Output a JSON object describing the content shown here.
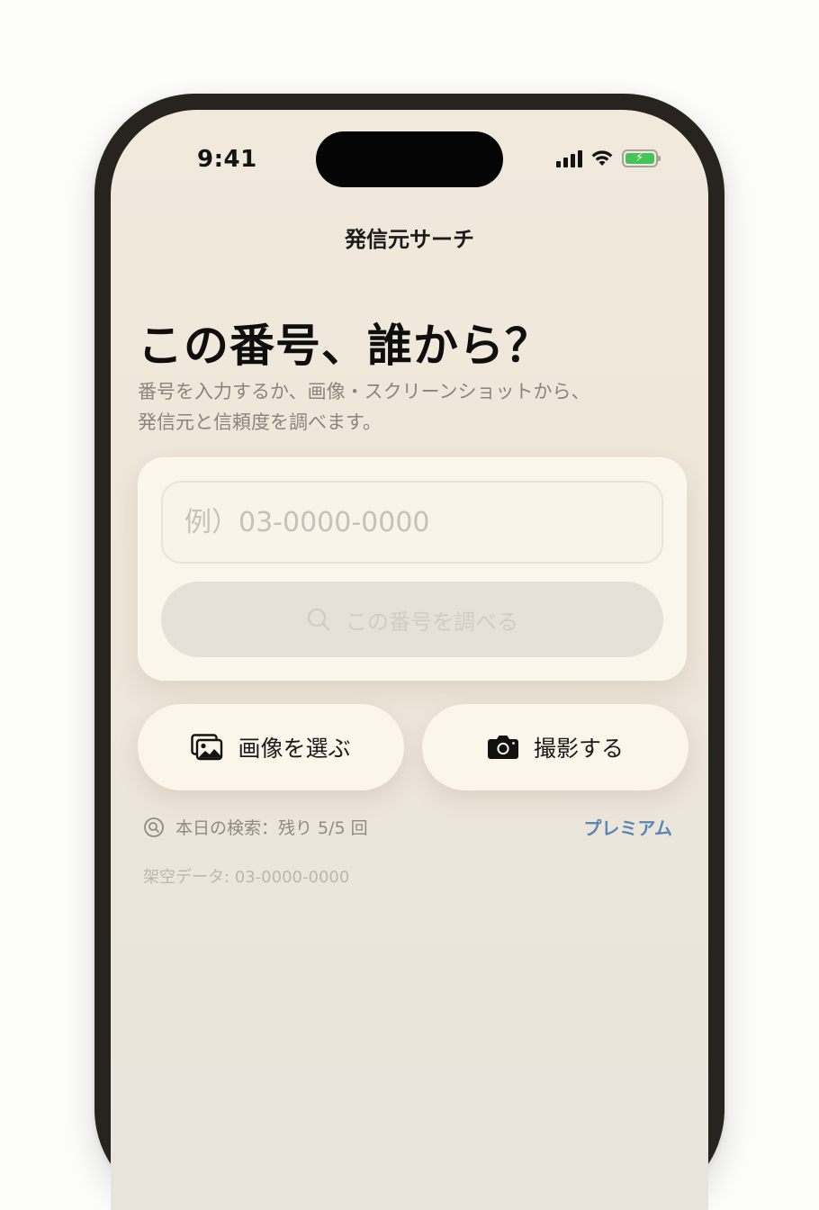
{
  "status_bar": {
    "time": "9:41"
  },
  "nav": {
    "title": "発信元サーチ"
  },
  "hero": {
    "headline": "この番号、誰から？",
    "subtitle_line1": "番号を入力するか、画像・スクリーンショットから、",
    "subtitle_line2": "発信元と信頼度を調べます。"
  },
  "search": {
    "input_placeholder": "例）03-0000-0000",
    "input_value": "",
    "button_label": "この番号を調べる",
    "button_icon": "search-icon"
  },
  "actions": {
    "choose_image_label": "画像を選ぶ",
    "choose_image_icon": "photo-library-icon",
    "camera_label": "撮影する",
    "camera_icon": "camera-icon"
  },
  "quota": {
    "text": "本日の検索：残り 5/5 回",
    "remaining": 5,
    "total": 5
  },
  "premium_link": "プレミアム",
  "sample_data": "架空データ: 03-0000-0000",
  "colors": {
    "background": "#f1e9dc",
    "card": "#fbf6ec",
    "accent_link": "#5a87b3",
    "battery_fill": "#46c45a",
    "disabled_button": "#e6e0d8"
  }
}
